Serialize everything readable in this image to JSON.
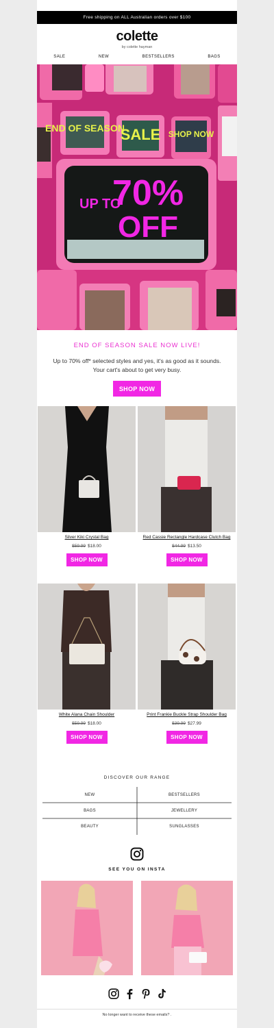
{
  "topbar": {
    "text": "Free shipping on ALL Australian orders over $100"
  },
  "brand": {
    "logo": "colette",
    "tagline": "by colette hayman"
  },
  "nav": {
    "items": [
      "SALE",
      "NEW",
      "BESTSELLERS",
      "BAGS"
    ]
  },
  "hero": {
    "tile_1": "END OF SEASON",
    "tile_2": "SALE",
    "tile_3": "SHOP NOW",
    "big_up": "UP TO",
    "big_pct": "70%",
    "big_off": "OFF"
  },
  "promo": {
    "headline": "END OF SEASON SALE NOW LIVE!",
    "body": "Up to 70% off* selected styles and yes, it's as good as it sounds. Your cart's about to get very busy.",
    "button": "SHOP NOW"
  },
  "products": [
    {
      "name": "Silver Kiki Crystal Bag",
      "was": "$59.99",
      "now": "$18.00",
      "button": "SHOP NOW"
    },
    {
      "name": "Red Cassie Rectangle Hardcase Clutch Bag",
      "was": "$44.99",
      "now": "$13.50",
      "button": "SHOP NOW"
    },
    {
      "name": "White Alana Chain Shoulder",
      "was": "$59.99",
      "now": "$18.00",
      "button": "SHOP NOW"
    },
    {
      "name": "Print Frankie Buckle Strap Shoulder Bag",
      "was": "$39.99",
      "now": "$27.99",
      "button": "SHOP NOW"
    }
  ],
  "range": {
    "title": "DISCOVER OUR RANGE",
    "links": [
      "NEW",
      "BESTSELLERS",
      "BAGS",
      "JEWELLERY",
      "BEAUTY",
      "SUNGLASSES"
    ]
  },
  "insta": {
    "title": "SEE YOU ON INSTA"
  },
  "social": {
    "icons": [
      "instagram-icon",
      "facebook-icon",
      "pinterest-icon",
      "tiktok-icon"
    ]
  },
  "footer": {
    "unsubscribe": "No longer want to receive these emails? ."
  },
  "colors": {
    "accent": "#f127e4",
    "hero_pink": "#e83d8f",
    "dark": "#000000"
  }
}
